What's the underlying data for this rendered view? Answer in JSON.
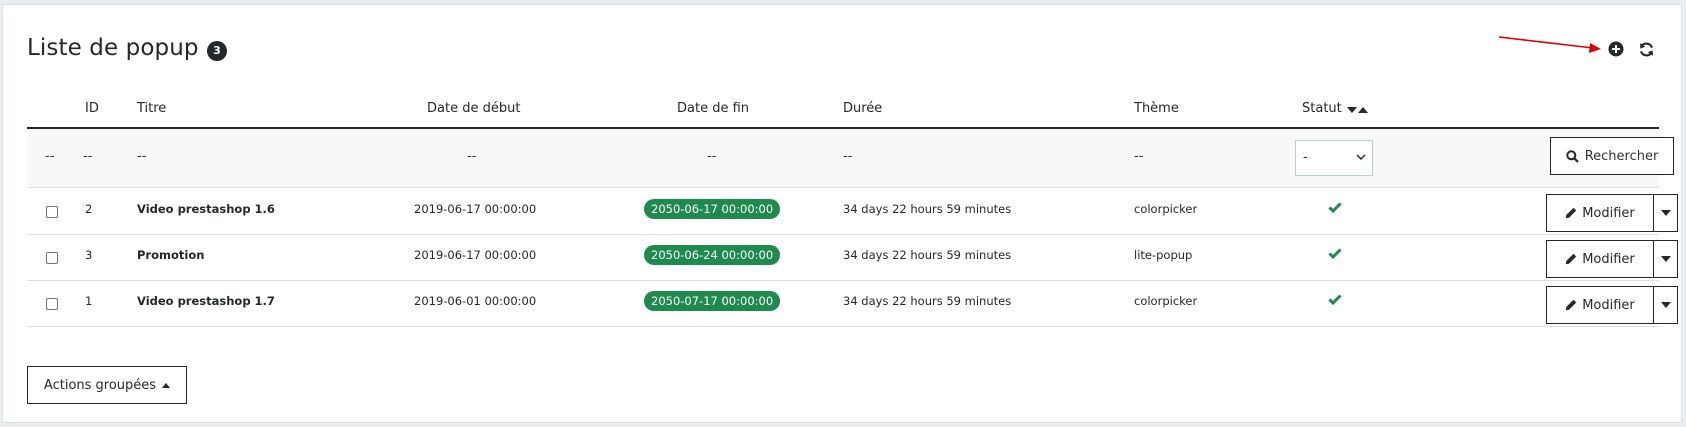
{
  "header": {
    "title": "Liste de popup",
    "count": "3"
  },
  "columns": {
    "id": "ID",
    "title": "Titre",
    "start_date": "Date de début",
    "end_date": "Date de fin",
    "duration": "Durée",
    "theme": "Thème",
    "status": "Statut"
  },
  "filters": {
    "placeholder": "--",
    "status_selected": "-",
    "search_label": "Rechercher"
  },
  "rows": [
    {
      "id": "2",
      "title": "Video prestashop 1.6",
      "start": "2019-06-17 00:00:00",
      "end": "2050-06-17 00:00:00",
      "duration": "34 days 22 hours 59 minutes",
      "theme": "colorpicker",
      "edit": "Modifier"
    },
    {
      "id": "3",
      "title": "Promotion",
      "start": "2019-06-17 00:00:00",
      "end": "2050-06-24 00:00:00",
      "duration": "34 days 22 hours 59 minutes",
      "theme": "lite-popup",
      "edit": "Modifier"
    },
    {
      "id": "1",
      "title": "Video prestashop 1.7",
      "start": "2019-06-01 00:00:00",
      "end": "2050-07-17 00:00:00",
      "duration": "34 days 22 hours 59 minutes",
      "theme": "colorpicker",
      "edit": "Modifier"
    }
  ],
  "bulk": {
    "label": "Actions groupées"
  },
  "colors": {
    "accent_green": "#1e8a4e",
    "annotation_red": "#e00000",
    "text_dark": "#25282b"
  },
  "icons": [
    "plus-circle-icon",
    "refresh-icon",
    "search-icon",
    "pencil-icon",
    "check-icon",
    "caret-down-icon",
    "caret-up-icon",
    "annotation-arrow"
  ]
}
